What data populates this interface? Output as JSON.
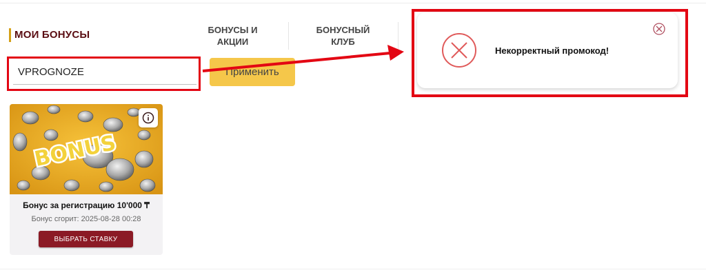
{
  "header": {
    "title": "МОИ БОНУСЫ",
    "tabs": [
      {
        "label": "БОНУСЫ И\nАКЦИИ"
      },
      {
        "label": "БОНУСНЫЙ\nКЛУБ"
      }
    ]
  },
  "promo": {
    "value": "VPROGNOZE",
    "apply_label": "Применить"
  },
  "toast": {
    "message": "Некорректный промокод!",
    "icons": {
      "status": "error-x-icon",
      "close": "close-circle-icon"
    }
  },
  "bonus_card": {
    "image_text": "BONUS",
    "title": "Бонус за регистрацию 10'000 ₸",
    "expiry": "Бонус сгорит: 2025-08-28 00:28",
    "button_label": "ВЫБРАТЬ СТАВКУ",
    "icons": {
      "info": "info-icon"
    }
  },
  "colors": {
    "accent_red": "#e30613",
    "brand_maroon": "#8b1a25",
    "button_yellow": "#f5c74a",
    "title_color": "#5a0d12"
  }
}
